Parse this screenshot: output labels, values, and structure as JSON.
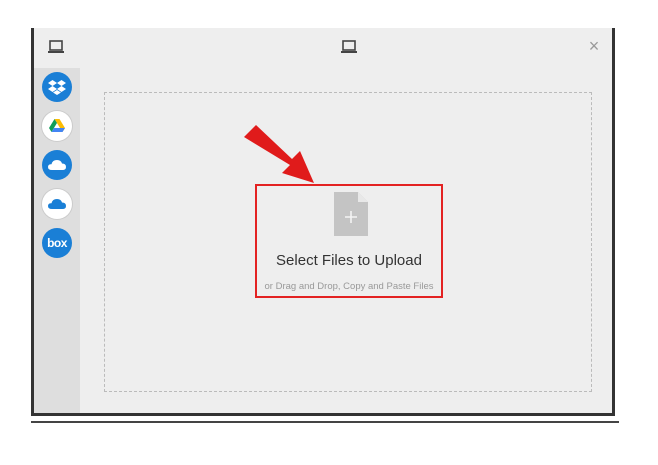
{
  "dialog": {
    "close_glyph": "×"
  },
  "sources": [
    {
      "name": "Dropbox",
      "icon": "dropbox-icon",
      "color": "#1a7fd6"
    },
    {
      "name": "Google Drive",
      "icon": "google-drive-icon",
      "color": "#ffffff"
    },
    {
      "name": "OneDrive",
      "icon": "onedrive-icon",
      "color": "#1a7fd6"
    },
    {
      "name": "OneDrive for Business",
      "icon": "onedrive-business-icon",
      "color": "#ffffff"
    },
    {
      "name": "Box",
      "icon": "box-icon",
      "color": "#1a7fd6",
      "label": "box"
    }
  ],
  "upload": {
    "title": "Select Files to Upload",
    "subtitle": "or Drag and Drop, Copy and Paste Files",
    "highlight_color": "#e32222"
  }
}
